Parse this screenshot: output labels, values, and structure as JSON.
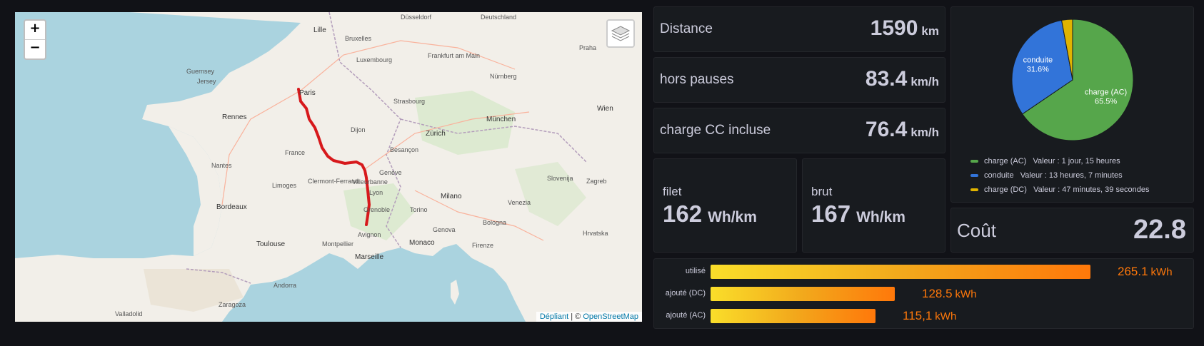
{
  "map": {
    "zoom_in": "+",
    "zoom_out": "−",
    "attribution_leaflet": "Dépliant",
    "attribution_sep": " | © ",
    "attribution_osm": "OpenStreetMap",
    "route_color": "#d7191c",
    "places": [
      {
        "name": "Paris",
        "cls": "city"
      },
      {
        "name": "Lille",
        "cls": "city"
      },
      {
        "name": "Rennes",
        "cls": "city"
      },
      {
        "name": "France",
        "cls": ""
      },
      {
        "name": "Bordeaux",
        "cls": "city"
      },
      {
        "name": "Toulouse",
        "cls": "city"
      },
      {
        "name": "Marseille",
        "cls": "city"
      },
      {
        "name": "Montpellier",
        "cls": ""
      },
      {
        "name": "Avignon",
        "cls": ""
      },
      {
        "name": "Villeurbanne",
        "cls": ""
      },
      {
        "name": "Grenoble",
        "cls": ""
      },
      {
        "name": "Genève",
        "cls": ""
      },
      {
        "name": "Zürich",
        "cls": "city"
      },
      {
        "name": "Strasbourg",
        "cls": ""
      },
      {
        "name": "München",
        "cls": "city"
      },
      {
        "name": "Milano",
        "cls": "city"
      },
      {
        "name": "Torino",
        "cls": ""
      },
      {
        "name": "Monaco",
        "cls": "city"
      },
      {
        "name": "Bologna",
        "cls": ""
      },
      {
        "name": "Firenze",
        "cls": ""
      },
      {
        "name": "Wien",
        "cls": "city"
      },
      {
        "name": "Praha",
        "cls": ""
      },
      {
        "name": "Zagreb",
        "cls": ""
      },
      {
        "name": "Frankfurt am Main",
        "cls": ""
      },
      {
        "name": "Nürnberg",
        "cls": ""
      },
      {
        "name": "Deutschland",
        "cls": ""
      },
      {
        "name": "Luxembourg",
        "cls": ""
      },
      {
        "name": "Bruxelles",
        "cls": ""
      },
      {
        "name": "Düsseldorf",
        "cls": ""
      },
      {
        "name": "Andorra",
        "cls": ""
      },
      {
        "name": "Zaragoza",
        "cls": ""
      },
      {
        "name": "Valladolid",
        "cls": ""
      },
      {
        "name": "Guernsey",
        "cls": ""
      },
      {
        "name": "Jersey",
        "cls": ""
      },
      {
        "name": "Nantes",
        "cls": ""
      },
      {
        "name": "Limoges",
        "cls": ""
      },
      {
        "name": "Clermont-Ferrand",
        "cls": ""
      },
      {
        "name": "Dijon",
        "cls": ""
      },
      {
        "name": "Besançon",
        "cls": ""
      },
      {
        "name": "Lyon",
        "cls": ""
      },
      {
        "name": "Slovenija",
        "cls": ""
      },
      {
        "name": "Hrvatska",
        "cls": ""
      },
      {
        "name": "Venezia",
        "cls": ""
      },
      {
        "name": "Genova",
        "cls": ""
      }
    ]
  },
  "stats": {
    "distance": {
      "label": "Distance",
      "value": "1590",
      "unit": "km"
    },
    "hors_pauses": {
      "label": "hors pauses",
      "value": "83.4",
      "unit": "km/h"
    },
    "charge_cc": {
      "label": "charge CC incluse",
      "value": "76.4",
      "unit": "km/h"
    },
    "filet": {
      "label": "filet",
      "value": "162",
      "unit": "Wh/km"
    },
    "brut": {
      "label": "brut",
      "value": "167",
      "unit": "Wh/km"
    },
    "cout": {
      "label": "Coût",
      "value": "22.8"
    }
  },
  "pie": {
    "slices": [
      {
        "name": "charge (AC)",
        "pct": "65.5%",
        "fraction": 0.655,
        "color": "#56a64b",
        "legend_value": "Valeur : 1 jour, 15 heures"
      },
      {
        "name": "conduite",
        "pct": "31.6%",
        "fraction": 0.316,
        "color": "#3274d9",
        "legend_value": "Valeur : 13 heures, 7 minutes"
      },
      {
        "name": "charge (DC)",
        "pct": "",
        "fraction": 0.029,
        "color": "#e0b400",
        "legend_value": "Valeur : 47 minutes, 39 secondes"
      }
    ]
  },
  "bars": [
    {
      "label": "utilisé",
      "value": "265.1",
      "unit": "kWh",
      "fraction": 1.0
    },
    {
      "label": "ajouté (DC)",
      "value": "128.5",
      "unit": "kWh",
      "fraction": 0.485
    },
    {
      "label": "ajouté (AC)",
      "value": "115,1",
      "unit": "kWh",
      "fraction": 0.434
    }
  ],
  "bar_color": "#ff780a"
}
